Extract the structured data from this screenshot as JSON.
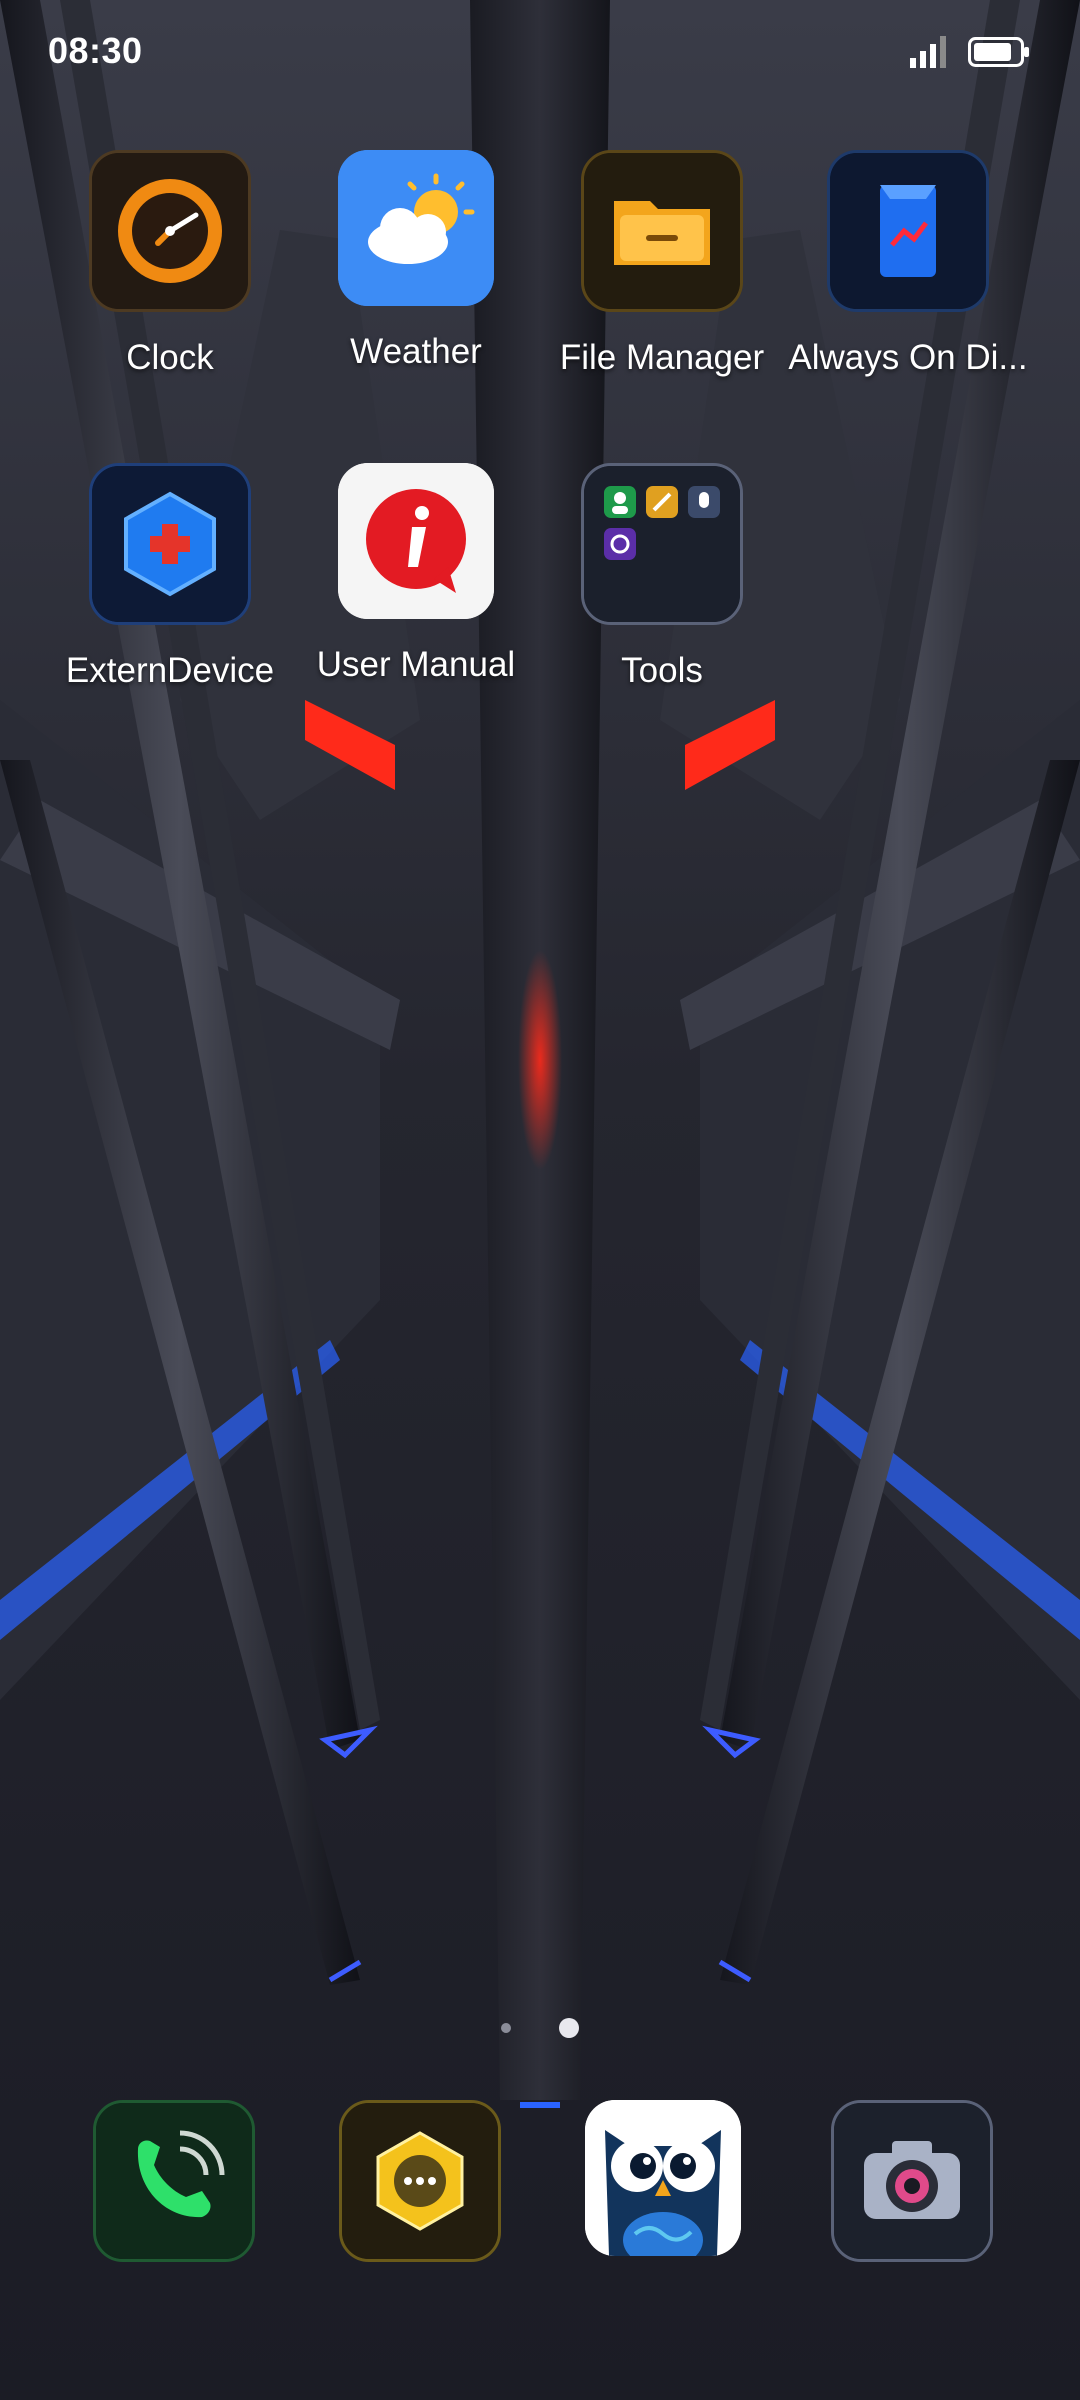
{
  "status_bar": {
    "time": "08:30",
    "icons": [
      "signal-icon",
      "battery-icon"
    ]
  },
  "home_apps": [
    {
      "label": "Clock",
      "icon": "clock-icon"
    },
    {
      "label": "Weather",
      "icon": "weather-icon"
    },
    {
      "label": "File Manager",
      "icon": "folder-icon"
    },
    {
      "label": "Always On Di...",
      "icon": "always-on-display-icon"
    },
    {
      "label": "ExternDevice",
      "icon": "gamepad-icon"
    },
    {
      "label": "User Manual",
      "icon": "info-icon"
    },
    {
      "label": "Tools",
      "icon": "folder-grid-icon"
    }
  ],
  "page_indicator": {
    "pages": 2,
    "current": 2
  },
  "dock": [
    {
      "icon": "phone-icon"
    },
    {
      "icon": "messages-icon"
    },
    {
      "icon": "owl-icon"
    },
    {
      "icon": "camera-icon"
    }
  ],
  "colors": {
    "accent_red": "#ff2a1a",
    "accent_blue": "#2a63ff",
    "weather_bg": "#3d8cf5",
    "manual_red": "#e31b23"
  }
}
